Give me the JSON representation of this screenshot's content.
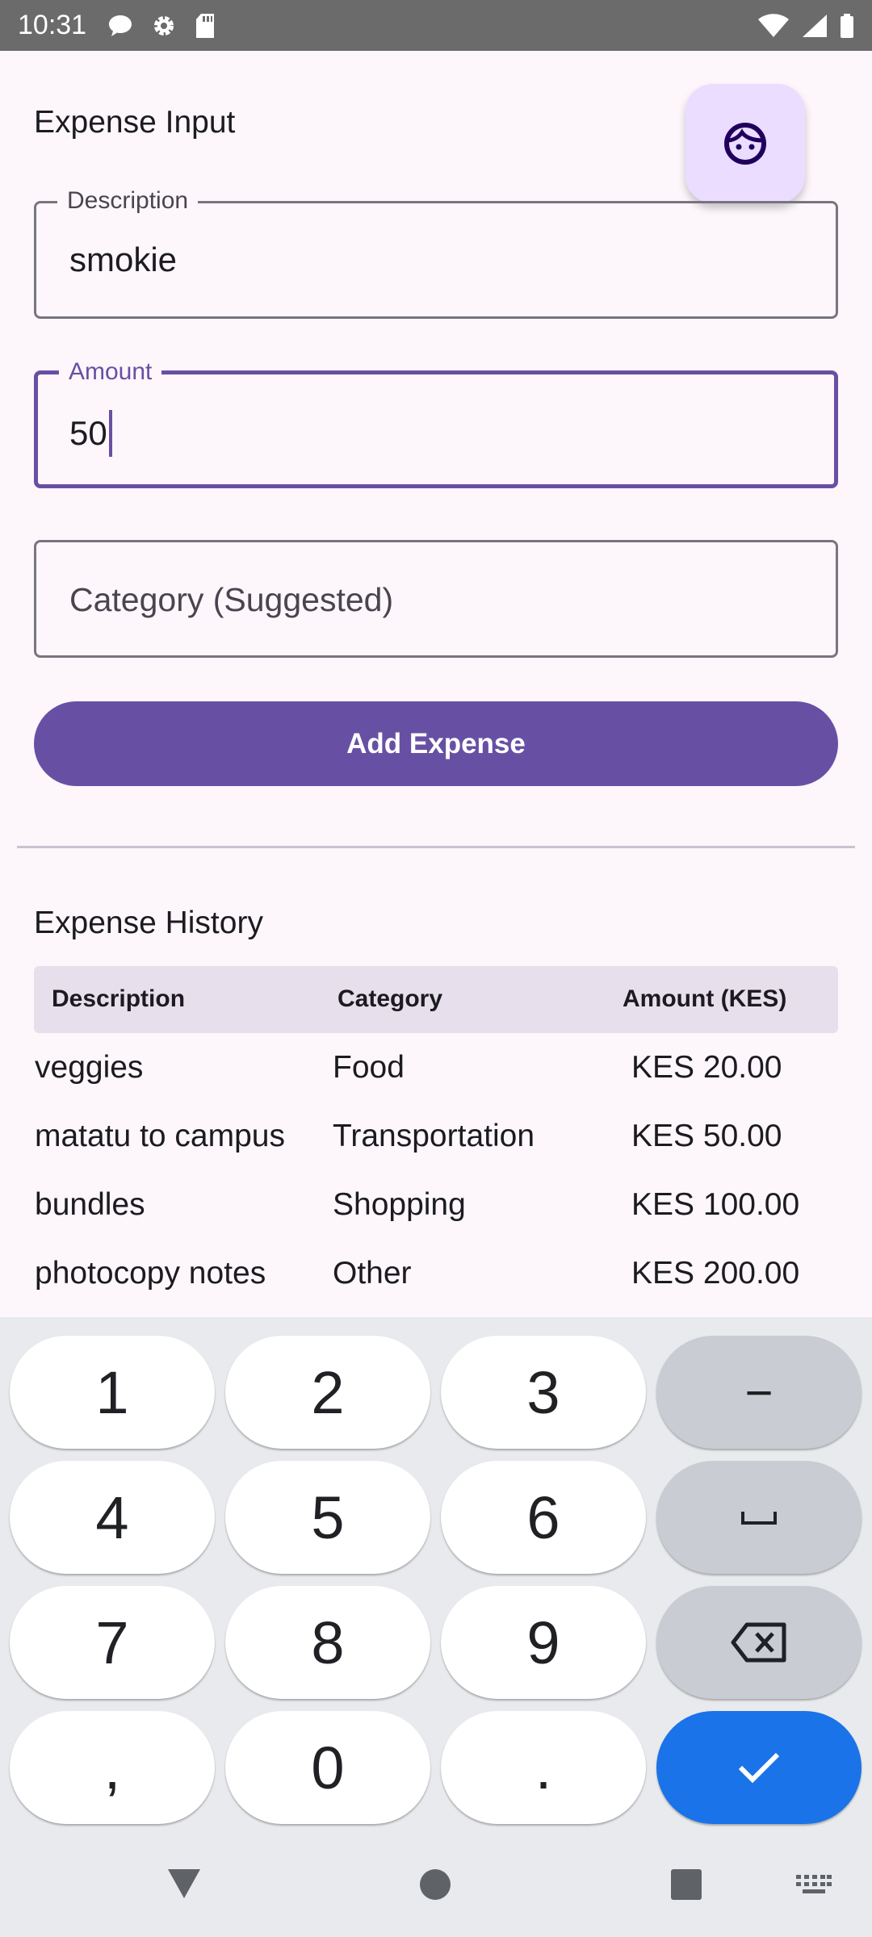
{
  "status_bar": {
    "time": "10:31",
    "left_icons": [
      "chat-icon",
      "settings-icon",
      "sd-card-icon"
    ],
    "right_icons": [
      "wifi-icon",
      "signal-icon",
      "battery-icon"
    ]
  },
  "form": {
    "title": "Expense Input",
    "description_label": "Description",
    "description_value": "smokie",
    "amount_label": "Amount",
    "amount_value": "50",
    "category_placeholder": "Category (Suggested)",
    "add_button_label": "Add Expense"
  },
  "history": {
    "title": "Expense History",
    "columns": [
      "Description",
      "Category",
      "Amount (KES)"
    ],
    "rows": [
      {
        "description": "veggies",
        "category": "Food",
        "amount": "KES 20.00"
      },
      {
        "description": "matatu to campus",
        "category": "Transportation",
        "amount": "KES 50.00"
      },
      {
        "description": "bundles",
        "category": "Shopping",
        "amount": "KES 100.00"
      },
      {
        "description": "photocopy notes",
        "category": "Other",
        "amount": "KES 200.00"
      }
    ]
  },
  "keyboard": {
    "row1": [
      "1",
      "2",
      "3",
      "−"
    ],
    "row2": [
      "4",
      "5",
      "6",
      "space-icon"
    ],
    "row3": [
      "7",
      "8",
      "9",
      "backspace-icon"
    ],
    "row4": [
      ",",
      "0",
      ".",
      "check-icon"
    ]
  },
  "nav_bar": {
    "icons": [
      "back-icon",
      "home-icon",
      "recents-icon",
      "keyboard-icon"
    ]
  },
  "colors": {
    "primary": "#6750a4",
    "fab_container": "#eaddff",
    "enter_key": "#1a73e8",
    "status_bar": "#6b6b6b"
  }
}
